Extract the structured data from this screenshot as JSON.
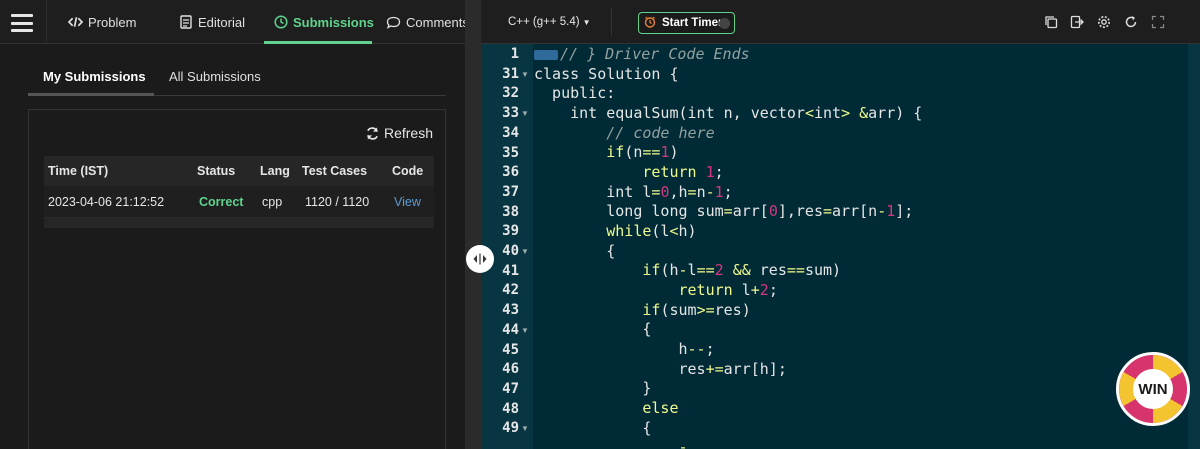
{
  "nav": {
    "tabs": [
      {
        "label": "Problem",
        "icon": "code-icon"
      },
      {
        "label": "Editorial",
        "icon": "document-icon"
      },
      {
        "label": "Submissions",
        "icon": "clock-icon"
      },
      {
        "label": "Comments",
        "icon": "comment-icon"
      }
    ],
    "active_tab": "Submissions",
    "accent_color": "#5fd38d"
  },
  "subtabs": [
    "My Submissions",
    "All Submissions"
  ],
  "refresh_label": "Refresh",
  "table": {
    "headers": [
      "Time (IST)",
      "Status",
      "Lang",
      "Test Cases",
      "Code"
    ],
    "rows": [
      {
        "time": "2023-04-06 21:12:52",
        "status": "Correct",
        "lang": "cpp",
        "tests": "1120 / 1120",
        "code": "View"
      }
    ]
  },
  "toolbar": {
    "language": "C++ (g++ 5.4)",
    "timer_label": "Start Timer",
    "icons": [
      "copy-icon",
      "export-icon",
      "settings-icon",
      "reset-icon",
      "fullscreen-icon"
    ]
  },
  "editor": {
    "lines": [
      {
        "n": "1",
        "fold": false
      },
      {
        "n": "31",
        "fold": true
      },
      {
        "n": "32",
        "fold": false
      },
      {
        "n": "33",
        "fold": true
      },
      {
        "n": "34",
        "fold": false
      },
      {
        "n": "35",
        "fold": false
      },
      {
        "n": "36",
        "fold": false
      },
      {
        "n": "37",
        "fold": false
      },
      {
        "n": "38",
        "fold": false
      },
      {
        "n": "39",
        "fold": false
      },
      {
        "n": "40",
        "fold": true
      },
      {
        "n": "41",
        "fold": false
      },
      {
        "n": "42",
        "fold": false
      },
      {
        "n": "43",
        "fold": false
      },
      {
        "n": "44",
        "fold": true
      },
      {
        "n": "45",
        "fold": false
      },
      {
        "n": "46",
        "fold": false
      },
      {
        "n": "47",
        "fold": false
      },
      {
        "n": "48",
        "fold": false
      },
      {
        "n": "49",
        "fold": true
      }
    ]
  },
  "win_badge": "WIN"
}
